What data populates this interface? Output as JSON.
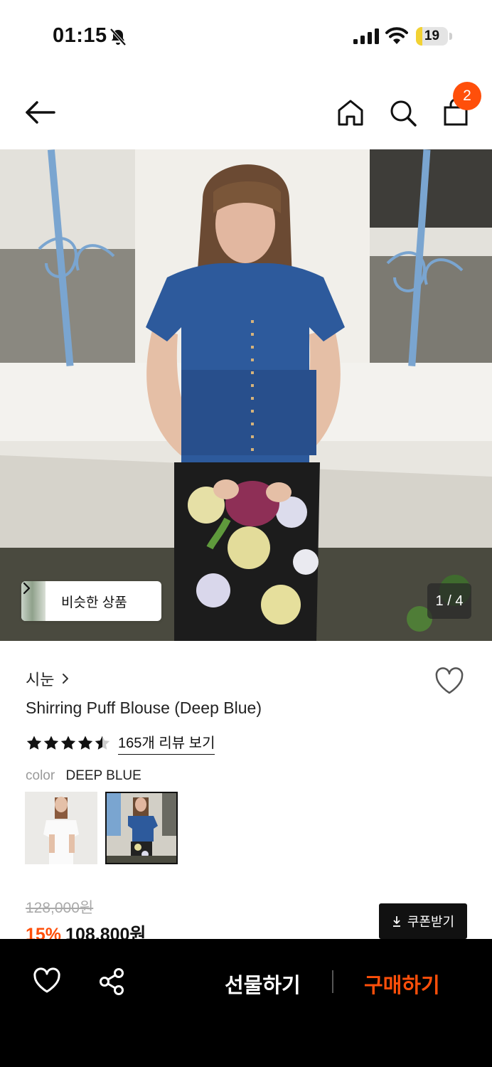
{
  "status_bar": {
    "time": "01:15",
    "battery": "19",
    "battery_level": 0.19,
    "icons": [
      "bell-slash-icon",
      "cellular-signal-icon",
      "wifi-icon",
      "battery-icon"
    ]
  },
  "header": {
    "cart_count": "2",
    "icons": [
      "arrow-left-icon",
      "home-icon",
      "search-icon",
      "shopping-bag-icon"
    ]
  },
  "gallery": {
    "similar_label": "비슷한 상품",
    "page_indicator": "1 / 4",
    "current_page": 1,
    "total_pages": 4
  },
  "product": {
    "brand": "시눈",
    "title": "Shirring Puff Blouse (Deep Blue)",
    "rating": 4.5,
    "review_link": "165개 리뷰 보기",
    "color_label": "color",
    "color_value": "DEEP BLUE",
    "original_price": "128,000원",
    "discount": "15%",
    "price": "108,800원",
    "coupon_label": "쿠폰받기"
  },
  "bottom_bar": {
    "gift_label": "선물하기",
    "buy_label": "구매하기"
  },
  "colors": {
    "accent": "#ff4f0a",
    "battery_fill": "#f2d233",
    "bottom_bar_bg": "#000000"
  }
}
